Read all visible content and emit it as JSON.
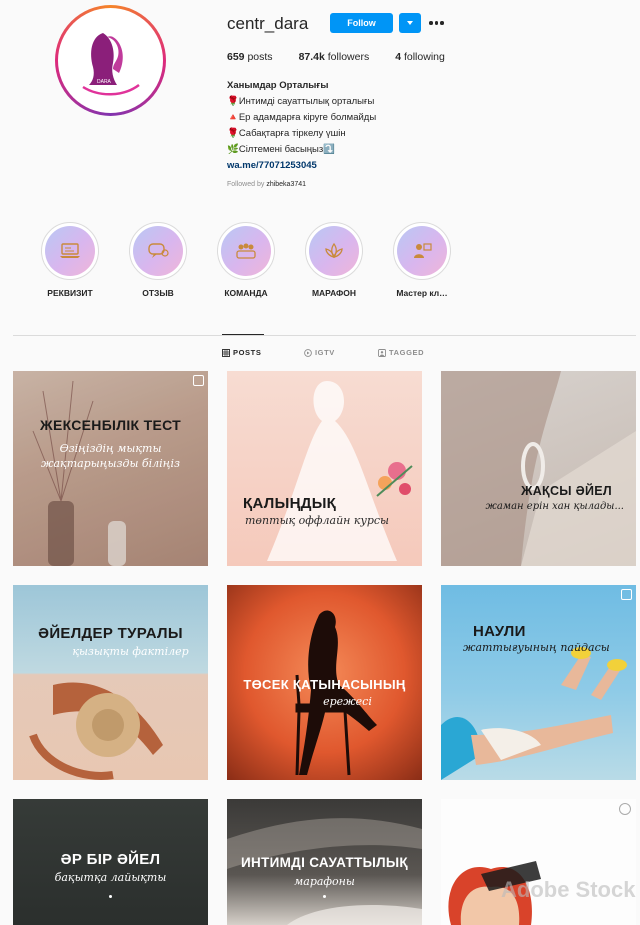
{
  "profile": {
    "username": "centr_dara",
    "follow_label": "Follow",
    "posts_count": "659",
    "posts_label": "posts",
    "followers_count": "87.4k",
    "followers_label": "followers",
    "following_count": "4",
    "following_label": "following",
    "avatar_text": "DARA"
  },
  "bio": {
    "name": "Ханымдар Орталығы",
    "line1": "🌹Интимді сауаттылық орталығы",
    "line2": "🔺Ер адамдарға кіруге болмайды",
    "line3": "🌹Сабақтарға тіркелу үшін",
    "line4": "🌿Сілтемені басыңыз⤵️",
    "link": "wa.me/77071253045",
    "followed_prefix": "Followed by",
    "followed_user": "zhibeka3741"
  },
  "highlights": [
    {
      "label": "РЕКВИЗИТ",
      "icon": "laptop-icon"
    },
    {
      "label": "ОТЗЫВ",
      "icon": "chat-bubble-icon"
    },
    {
      "label": "КОМАНДА",
      "icon": "team-icon"
    },
    {
      "label": "МАРАФОН",
      "icon": "lotus-icon"
    },
    {
      "label": "Мастер кл…",
      "icon": "masterclass-icon"
    }
  ],
  "tabs": {
    "posts": "POSTS",
    "igtv": "IGTV",
    "tagged": "TAGGED"
  },
  "posts": [
    {
      "title": "ЖЕКСЕНБІЛІК ТЕСТ",
      "subtitle": "Өзіңіздің мықты жақтарыңызды біліңіз"
    },
    {
      "title": "ҚАЛЫҢДЫҚ",
      "subtitle": "төптық оффлайн курсы"
    },
    {
      "title": "ЖАҚСЫ ӘЙЕЛ",
      "subtitle": "жаман ерін хан қылады..."
    },
    {
      "title": "ӘЙЕЛДЕР ТУРАЛЫ",
      "subtitle": "қызықты фактілер"
    },
    {
      "title": "ТӨСЕК ҚАТЫНАСЫНЫҢ",
      "subtitle": "ережесі"
    },
    {
      "title": "НАУЛИ",
      "subtitle": "жаттығуының пайдасы"
    },
    {
      "title": "ӘР БІР ӘЙЕЛ",
      "subtitle": "бақытқа лайықты"
    },
    {
      "title": "ИНТИМДІ САУАТТЫЛЫҚ",
      "subtitle": "марафоны"
    },
    {
      "title": "Adobe Stock",
      "subtitle": ""
    }
  ]
}
